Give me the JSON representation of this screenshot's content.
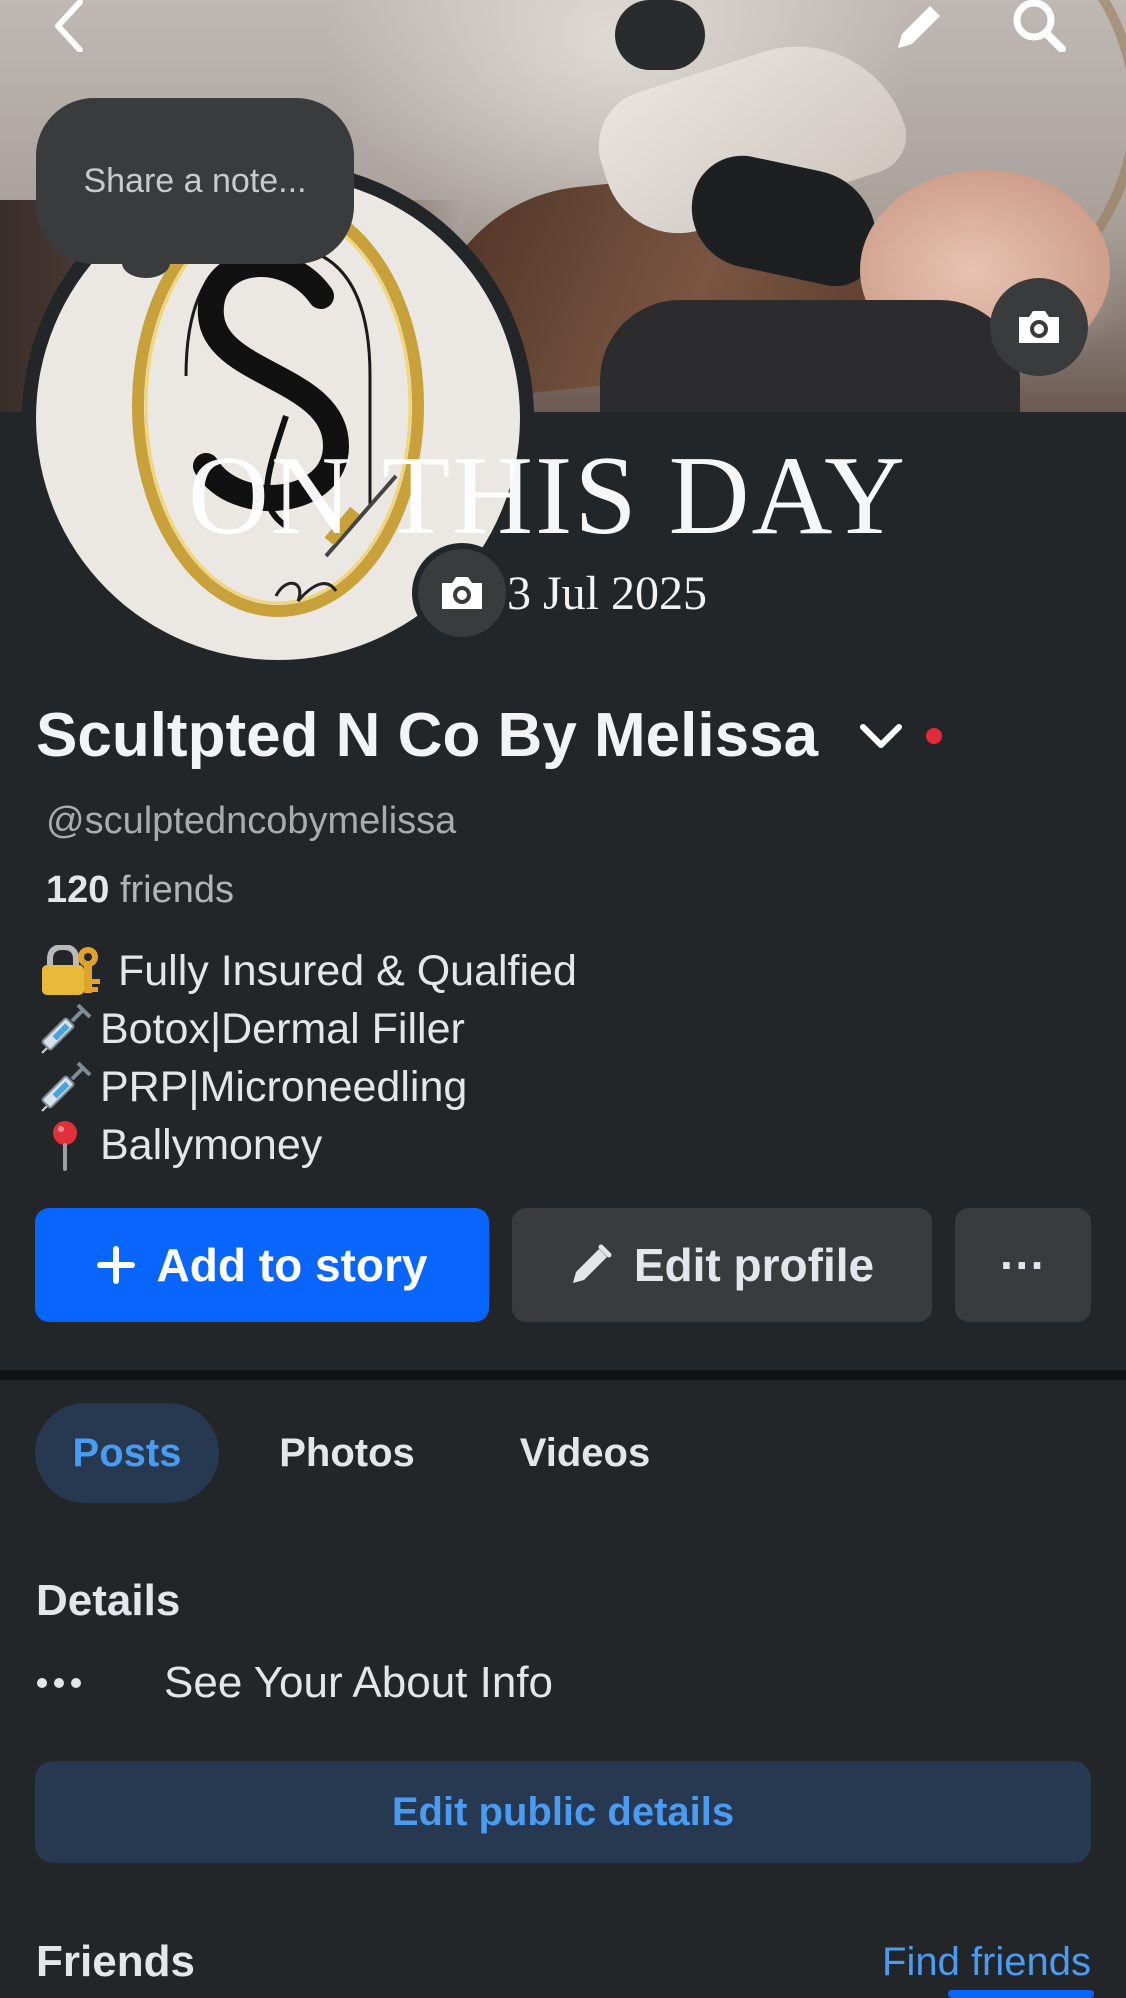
{
  "note": {
    "placeholder": "Share a note..."
  },
  "overlay": {
    "title": "ON THIS DAY",
    "date": "3 Jul 2025"
  },
  "profile": {
    "name": "Scultpted N Co By Melissa",
    "handle": "@sculptedncobymelissa",
    "friends_count": "120",
    "friends_label": "friends"
  },
  "bio": [
    {
      "icon": "lock-key-icon",
      "text": "Fully Insured & Qualfied"
    },
    {
      "icon": "syringe-icon",
      "text": "Botox|Dermal Filler"
    },
    {
      "icon": "syringe-icon",
      "text": "PRP|Microneedling"
    },
    {
      "icon": "pin-icon",
      "text": "Ballymoney"
    }
  ],
  "actions": {
    "add_story": "Add to story",
    "edit_profile": "Edit profile",
    "more": "···"
  },
  "tabs": [
    {
      "label": "Posts",
      "active": true
    },
    {
      "label": "Photos",
      "active": false
    },
    {
      "label": "Videos",
      "active": false
    }
  ],
  "details": {
    "title": "Details",
    "about": "See Your About Info",
    "edit_public": "Edit public details"
  },
  "friends_section": {
    "title": "Friends",
    "find": "Find friends"
  },
  "colors": {
    "background": "#232628",
    "primary_blue": "#0866ff",
    "link_blue": "#4a9bf2",
    "secondary_button": "#3a3b3c",
    "tab_active_bg": "#263951",
    "notification_red": "#e4293b"
  }
}
